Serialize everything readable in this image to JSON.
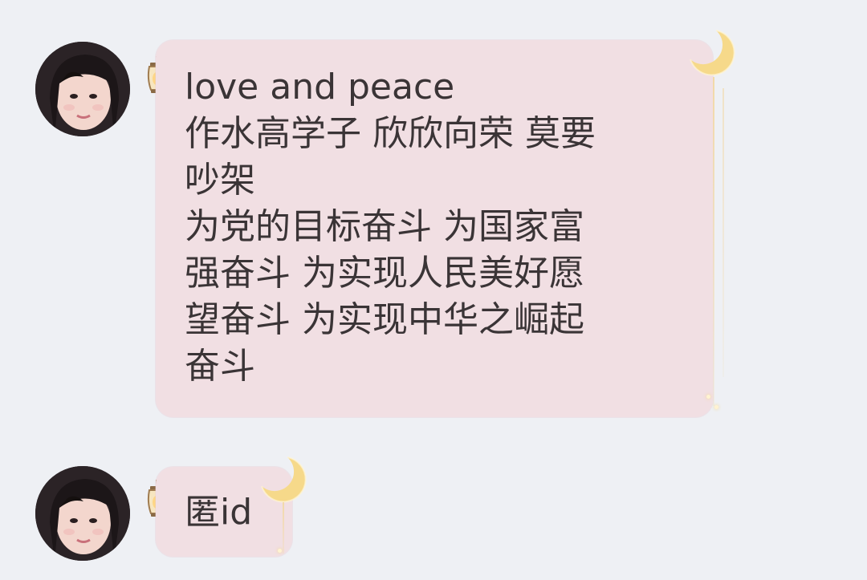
{
  "messages": [
    {
      "text": "love and peace\n作水高学子 欣欣向荣 莫要\n吵架\n为党的目标奋斗 为国家富\n强奋斗 为实现人民美好愿\n望奋斗 为实现中华之崛起\n奋斗"
    },
    {
      "text": "匿id"
    }
  ],
  "colors": {
    "background": "#eef0f4",
    "bubble": "#f1dfe3",
    "text": "#3a3436",
    "moon": "#f6d98a"
  },
  "icons": [
    "avatar",
    "lantern-icon",
    "moon-icon"
  ]
}
